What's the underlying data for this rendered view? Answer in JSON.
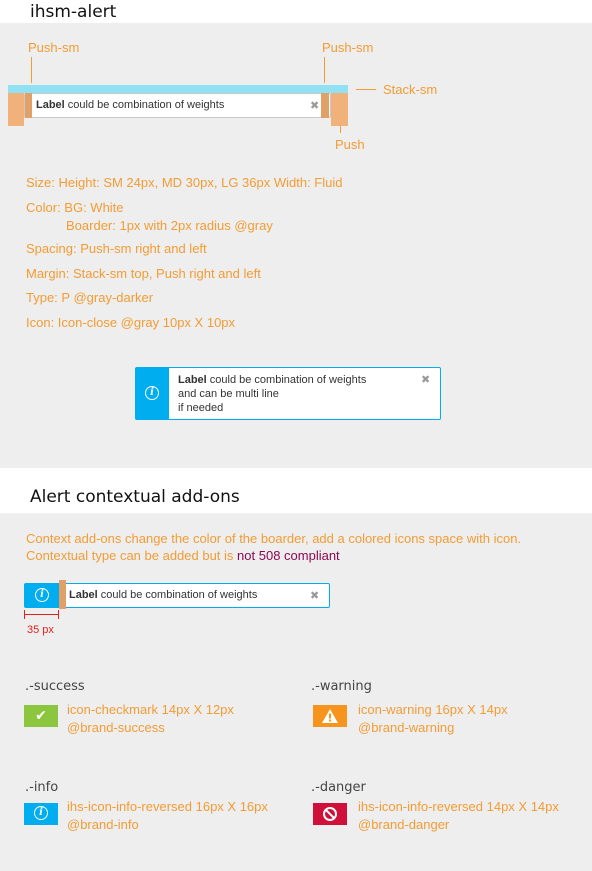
{
  "section1": {
    "title": "ihsm-alert",
    "annotations": {
      "push_sm_left": "Push-sm",
      "push_sm_right": "Push-sm",
      "stack_sm": "Stack-sm",
      "push": "Push"
    },
    "demo_alert": {
      "label_bold": "Label",
      "label_rest": " could be combination of weights",
      "close": "✖"
    },
    "specs": [
      "Size: Height: SM 24px, MD 30px, LG 36px  Width: Fluid",
      "Color: BG: White",
      "Boarder: 1px  with 2px radius @gray",
      "Spacing: Push-sm right and left",
      "Margin: Stack-sm top, Push right and left",
      "Type: P @gray-darker",
      "Icon: Icon-close @gray 10px X 10px"
    ],
    "multiline_alert": {
      "label_bold": "Label",
      "line1_rest": " could be combination of weights",
      "line2": "and can be multi line",
      "line3": "if needed",
      "icon": "i",
      "close": "✖"
    }
  },
  "section2": {
    "title": "Alert contextual add-ons",
    "desc_line1": "Context add-ons change the color of the boarder, add a colored icons space with icon.",
    "desc_line2_a": "Contextual type can be added but is ",
    "desc_line2_b": "not 508 compliant",
    "demo_alert": {
      "label_bold": "Label",
      "label_rest": " could be combination of weights",
      "icon": "i",
      "close": "✖",
      "measure": "35 px"
    },
    "variants": [
      {
        "title": ".-success",
        "spec1": "icon-checkmark 14px X 12px",
        "spec2": "@brand-success",
        "icon": "✔",
        "color": "#8cc63f"
      },
      {
        "title": ".-warning",
        "spec1": "icon-warning 16px X 14px",
        "spec2": "@brand-warning",
        "icon": "!",
        "color": "#f7941d"
      },
      {
        "title": ".-info",
        "spec1": "ihs-icon-info-reversed 16px X 16px",
        "spec2": "@brand-info",
        "icon": "i",
        "color": "#00aeef"
      },
      {
        "title": ".-danger",
        "spec1": "ihs-icon-info-reversed 14px X 14px",
        "spec2": "@brand-danger",
        "icon": "⊘",
        "color": "#d0103a"
      }
    ]
  },
  "colors": {
    "panel_bg": "#eeeeef",
    "annotation": "#f39c33",
    "stack_bar": "#8fe1f3",
    "push_block": "#f0b27a",
    "info": "#00aeef",
    "measure_red": "#e2231a",
    "non_compliant": "#8b0a50"
  }
}
